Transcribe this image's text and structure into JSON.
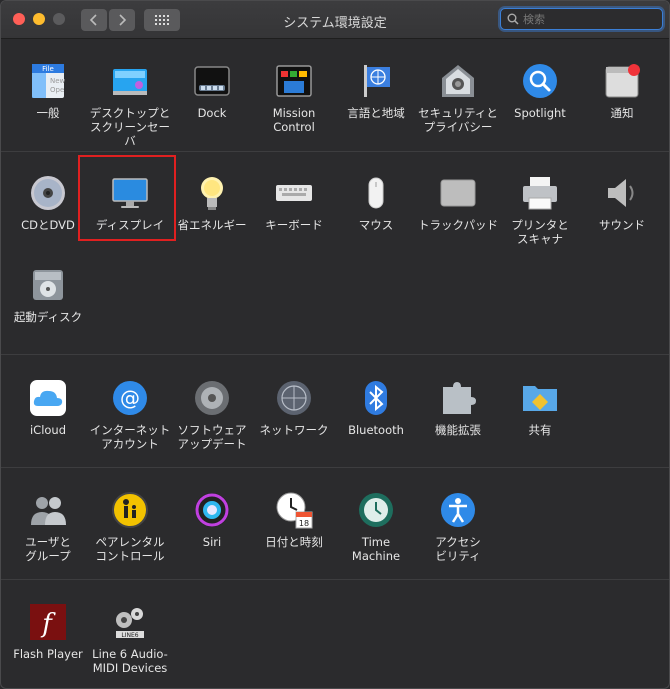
{
  "window": {
    "title": "システム環境設定"
  },
  "search": {
    "placeholder": "検索"
  },
  "sections": [
    {
      "items": [
        {
          "label": "一般",
          "icon": "general-icon"
        },
        {
          "label": "デスクトップと\nスクリーンセーバ",
          "icon": "desktop-icon"
        },
        {
          "label": "Dock",
          "icon": "dock-icon"
        },
        {
          "label": "Mission\nControl",
          "icon": "mission-control-icon"
        },
        {
          "label": "言語と地域",
          "icon": "language-icon"
        },
        {
          "label": "セキュリティと\nプライバシー",
          "icon": "security-icon"
        },
        {
          "label": "Spotlight",
          "icon": "spotlight-icon"
        },
        {
          "label": "通知",
          "icon": "notifications-icon"
        }
      ]
    },
    {
      "items": [
        {
          "label": "CDとDVD",
          "icon": "cd-dvd-icon"
        },
        {
          "label": "ディスプレイ",
          "icon": "display-icon"
        },
        {
          "label": "省エネルギー",
          "icon": "energy-saver-icon"
        },
        {
          "label": "キーボード",
          "icon": "keyboard-icon"
        },
        {
          "label": "マウス",
          "icon": "mouse-icon"
        },
        {
          "label": "トラックパッド",
          "icon": "trackpad-icon"
        },
        {
          "label": "プリンタと\nスキャナ",
          "icon": "printer-icon"
        },
        {
          "label": "サウンド",
          "icon": "sound-icon"
        },
        {
          "label": "起動ディスク",
          "icon": "startup-disk-icon"
        }
      ]
    },
    {
      "items": [
        {
          "label": "iCloud",
          "icon": "icloud-icon"
        },
        {
          "label": "インターネット\nアカウント",
          "icon": "internet-accounts-icon"
        },
        {
          "label": "ソフトウェア\nアップデート",
          "icon": "software-update-icon"
        },
        {
          "label": "ネットワーク",
          "icon": "network-icon"
        },
        {
          "label": "Bluetooth",
          "icon": "bluetooth-icon"
        },
        {
          "label": "機能拡張",
          "icon": "extensions-icon"
        },
        {
          "label": "共有",
          "icon": "sharing-icon"
        }
      ]
    },
    {
      "items": [
        {
          "label": "ユーザと\nグループ",
          "icon": "users-groups-icon"
        },
        {
          "label": "ペアレンタル\nコントロール",
          "icon": "parental-controls-icon"
        },
        {
          "label": "Siri",
          "icon": "siri-icon"
        },
        {
          "label": "日付と時刻",
          "icon": "date-time-icon"
        },
        {
          "label": "Time\nMachine",
          "icon": "time-machine-icon"
        },
        {
          "label": "アクセシ\nビリティ",
          "icon": "accessibility-icon"
        }
      ]
    },
    {
      "items": [
        {
          "label": "Flash Player",
          "icon": "flash-player-icon"
        },
        {
          "label": "Line 6 Audio-\nMIDI Devices",
          "icon": "line6-icon"
        }
      ]
    }
  ]
}
